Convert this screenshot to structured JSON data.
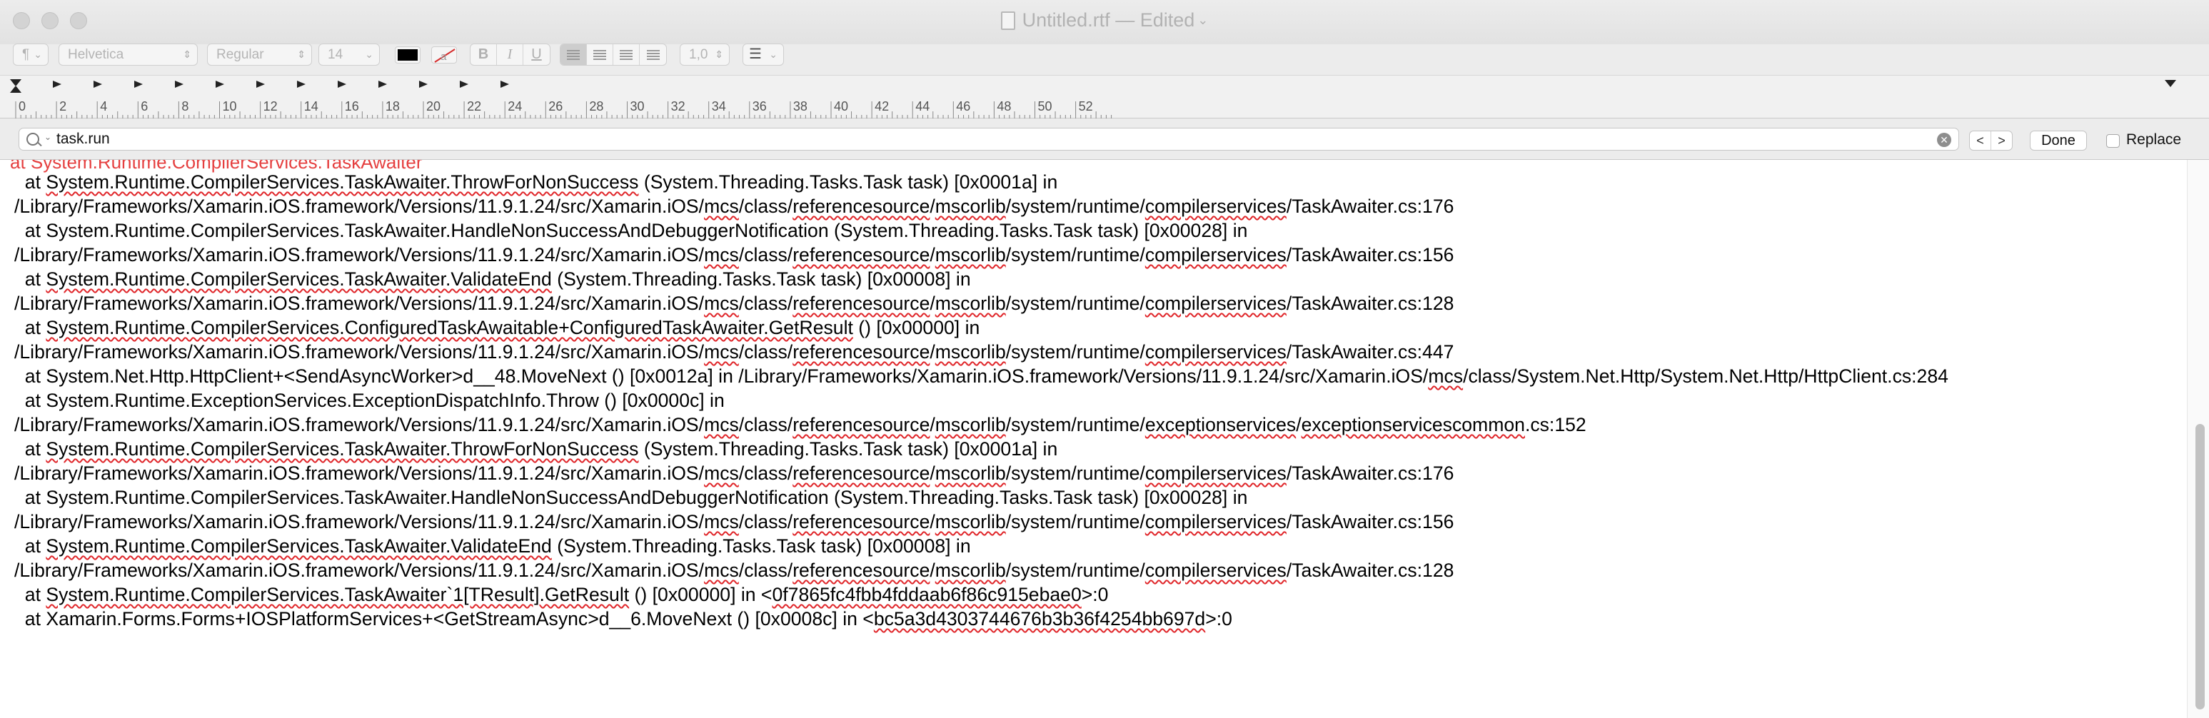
{
  "window": {
    "title": "Untitled.rtf",
    "status": "— Edited"
  },
  "toolbar": {
    "paragraph_style": "¶",
    "font_family": "Helvetica",
    "font_style": "Regular",
    "font_size": "14",
    "text_color": "#000000",
    "bold": "B",
    "italic": "I",
    "underline": "U",
    "line_spacing": "1,0",
    "list_icon": "list-bullets-icon"
  },
  "ruler": {
    "labels": [
      "0",
      "2",
      "4",
      "6",
      "8",
      "10",
      "12",
      "14",
      "16",
      "18",
      "20",
      "22",
      "24",
      "26",
      "28",
      "30",
      "32",
      "34",
      "36",
      "38",
      "40",
      "42",
      "44",
      "46",
      "48",
      "50",
      "52"
    ]
  },
  "find": {
    "query": "task.run",
    "prev": "<",
    "next": ">",
    "done_label": "Done",
    "replace_label": "Replace",
    "replace_checked": false
  },
  "document": {
    "cut_line": "at System.Runtime.CompilerServices.TaskAwaiter",
    "lines": [
      [
        {
          "t": "  at "
        },
        {
          "t": "System.Runtime.CompilerServices.TaskAwaiter.ThrowForNonSuccess",
          "s": 1
        },
        {
          "t": " (System.Threading.Tasks.Task task) [0x0001a] in /Library/Frameworks/Xamarin.iOS.framework/Versions/11.9.1.24/src/Xamarin.iOS/"
        },
        {
          "t": "mcs",
          "s": 1
        },
        {
          "t": "/class/"
        },
        {
          "t": "referencesource",
          "s": 1
        },
        {
          "t": "/"
        },
        {
          "t": "mscorlib",
          "s": 1
        },
        {
          "t": "/system/runtime/"
        },
        {
          "t": "compilerservices",
          "s": 1
        },
        {
          "t": "/TaskAwaiter.cs:176"
        }
      ],
      [
        {
          "t": "  at System.Runtime.CompilerServices.TaskAwaiter.HandleNonSuccessAndDebuggerNotification (System.Threading.Tasks.Task task) [0x00028] in /Library/Frameworks/Xamarin.iOS.framework/Versions/11.9.1.24/src/Xamarin.iOS/"
        },
        {
          "t": "mcs",
          "s": 1
        },
        {
          "t": "/class/"
        },
        {
          "t": "referencesource",
          "s": 1
        },
        {
          "t": "/"
        },
        {
          "t": "mscorlib",
          "s": 1
        },
        {
          "t": "/system/runtime/"
        },
        {
          "t": "compilerservices",
          "s": 1
        },
        {
          "t": "/TaskAwaiter.cs:156"
        }
      ],
      [
        {
          "t": "  at "
        },
        {
          "t": "System.Runtime.CompilerServices.TaskAwaiter.ValidateEnd",
          "s": 1
        },
        {
          "t": " (System.Threading.Tasks.Task task) [0x00008] in /Library/Frameworks/Xamarin.iOS.framework/Versions/11.9.1.24/src/Xamarin.iOS/"
        },
        {
          "t": "mcs",
          "s": 1
        },
        {
          "t": "/class/"
        },
        {
          "t": "referencesource",
          "s": 1
        },
        {
          "t": "/"
        },
        {
          "t": "mscorlib",
          "s": 1
        },
        {
          "t": "/system/runtime/"
        },
        {
          "t": "compilerservices",
          "s": 1
        },
        {
          "t": "/TaskAwaiter.cs:128"
        }
      ],
      [
        {
          "t": "  at "
        },
        {
          "t": "System.Runtime.CompilerServices.ConfiguredTaskAwaitable+ConfiguredTaskAwaiter.GetResult",
          "s": 1
        },
        {
          "t": " () [0x00000] in /Library/Frameworks/Xamarin.iOS.framework/Versions/11.9.1.24/src/Xamarin.iOS/"
        },
        {
          "t": "mcs",
          "s": 1
        },
        {
          "t": "/class/"
        },
        {
          "t": "referencesource",
          "s": 1
        },
        {
          "t": "/"
        },
        {
          "t": "mscorlib",
          "s": 1
        },
        {
          "t": "/system/runtime/"
        },
        {
          "t": "compilerservices",
          "s": 1
        },
        {
          "t": "/TaskAwaiter.cs:447"
        }
      ],
      [
        {
          "t": "  at System.Net.Http.HttpClient+<SendAsyncWorker>d__48.MoveNext () [0x0012a] in /Library/Frameworks/Xamarin.iOS.framework/Versions/11.9.1.24/src/Xamarin.iOS/"
        },
        {
          "t": "mcs",
          "s": 1
        },
        {
          "t": "/class/System.Net.Http/System.Net.Http/HttpClient.cs:284"
        }
      ],
      [
        {
          "t": "  at System.Runtime.ExceptionServices.ExceptionDispatchInfo.Throw () [0x0000c] in /Library/Frameworks/Xamarin.iOS.framework/Versions/11.9.1.24/src/Xamarin.iOS/"
        },
        {
          "t": "mcs",
          "s": 1
        },
        {
          "t": "/class/"
        },
        {
          "t": "referencesource",
          "s": 1
        },
        {
          "t": "/"
        },
        {
          "t": "mscorlib",
          "s": 1
        },
        {
          "t": "/system/runtime/"
        },
        {
          "t": "exceptionservices",
          "s": 1
        },
        {
          "t": "/"
        },
        {
          "t": "exceptionservicescommon",
          "s": 1
        },
        {
          "t": ".cs:152"
        }
      ],
      [
        {
          "t": "  at "
        },
        {
          "t": "System.Runtime.CompilerServices.TaskAwaiter.ThrowForNonSuccess",
          "s": 1
        },
        {
          "t": " (System.Threading.Tasks.Task task) [0x0001a] in /Library/Frameworks/Xamarin.iOS.framework/Versions/11.9.1.24/src/Xamarin.iOS/"
        },
        {
          "t": "mcs",
          "s": 1
        },
        {
          "t": "/class/"
        },
        {
          "t": "referencesource",
          "s": 1
        },
        {
          "t": "/"
        },
        {
          "t": "mscorlib",
          "s": 1
        },
        {
          "t": "/system/runtime/"
        },
        {
          "t": "compilerservices",
          "s": 1
        },
        {
          "t": "/TaskAwaiter.cs:176"
        }
      ],
      [
        {
          "t": "  at System.Runtime.CompilerServices.TaskAwaiter.HandleNonSuccessAndDebuggerNotification (System.Threading.Tasks.Task task) [0x00028] in /Library/Frameworks/Xamarin.iOS.framework/Versions/11.9.1.24/src/Xamarin.iOS/"
        },
        {
          "t": "mcs",
          "s": 1
        },
        {
          "t": "/class/"
        },
        {
          "t": "referencesource",
          "s": 1
        },
        {
          "t": "/"
        },
        {
          "t": "mscorlib",
          "s": 1
        },
        {
          "t": "/system/runtime/"
        },
        {
          "t": "compilerservices",
          "s": 1
        },
        {
          "t": "/TaskAwaiter.cs:156"
        }
      ],
      [
        {
          "t": "  at "
        },
        {
          "t": "System.Runtime.CompilerServices.TaskAwaiter.ValidateEnd",
          "s": 1
        },
        {
          "t": " (System.Threading.Tasks.Task task) [0x00008] in /Library/Frameworks/Xamarin.iOS.framework/Versions/11.9.1.24/src/Xamarin.iOS/"
        },
        {
          "t": "mcs",
          "s": 1
        },
        {
          "t": "/class/"
        },
        {
          "t": "referencesource",
          "s": 1
        },
        {
          "t": "/"
        },
        {
          "t": "mscorlib",
          "s": 1
        },
        {
          "t": "/system/runtime/"
        },
        {
          "t": "compilerservices",
          "s": 1
        },
        {
          "t": "/TaskAwaiter.cs:128"
        }
      ],
      [
        {
          "t": "  at "
        },
        {
          "t": "System.Runtime.CompilerServices.TaskAwaiter`1[TResult].GetResult",
          "s": 1
        },
        {
          "t": " () [0x00000] in <"
        },
        {
          "t": "0f7865fc4fbb4fddaab6f86c915ebae0",
          "s": 1
        },
        {
          "t": ">:0"
        }
      ],
      [
        {
          "t": "  at Xamarin.Forms.Forms+IOSPlatformServices+<GetStreamAsync>d__6.MoveNext () [0x0008c] in <"
        },
        {
          "t": "bc5a3d4303744676b3b36f4254bb697d",
          "s": 1
        },
        {
          "t": ">:0"
        }
      ]
    ]
  }
}
